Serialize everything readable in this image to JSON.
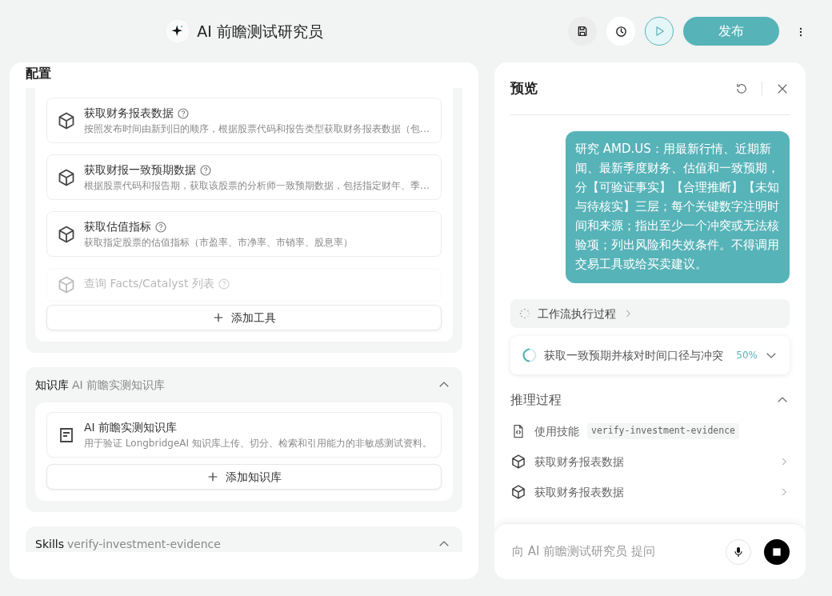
{
  "header": {
    "title": "AI 前瞻测试研究员",
    "publish_label": "发布"
  },
  "config": {
    "title": "配置",
    "tools": [
      {
        "name": "获取财务报表数据",
        "description": "按照发布时间由新到旧的顺序，根据股票代码和报告类型获取财务报表数据（包…"
      },
      {
        "name": "获取财报一致预期数据",
        "description": "根据股票代码和报告期，获取该股票的分析师一致预期数据，包括指定财年、季…"
      },
      {
        "name": "获取估值指标",
        "description": "获取指定股票的估值指标（市盈率、市净率、市销率、股息率）"
      },
      {
        "name": "查询 Facts/Catalyst 列表"
      }
    ],
    "add_tool_label": "添加工具",
    "sections": [
      {
        "kind": "knowledge",
        "title": "知识库",
        "subtitle": "AI 前瞻实测知识库",
        "expanded": true,
        "items": [
          {
            "name": "AI 前瞻实测知识库",
            "description": "用于验证 LongbridgeAI 知识库上传、切分、检索和引用能力的非敏感测试资料。"
          }
        ],
        "add_label": "添加知识库"
      },
      {
        "kind": "skills",
        "title": "Skills",
        "subtitle": "verify-investment-evidence",
        "expanded": true
      }
    ]
  },
  "preview": {
    "title": "预览",
    "message": "研究 AMD.US：用最新行情、近期新闻、最新季度财务、估值和一致预期，分【可验证事实】【合理推断】【未知与待核实】三层；每个关键数字注明时间和来源；指出至少一个冲突或无法核验项；列出风险和失效条件。不得调用交易工具或给买卖建议。",
    "workflow_label": "工作流执行过程",
    "task": {
      "label": "获取一致预期并核对时间口径与冲突",
      "percent": "50%",
      "expanded": false
    },
    "reasoning": {
      "title": "推理过程",
      "expanded": true,
      "steps": [
        {
          "kind": "skill",
          "label": "使用技能",
          "code": "verify-investment-evidence"
        },
        {
          "kind": "tool",
          "label": "获取财务报表数据"
        },
        {
          "kind": "tool",
          "label": "获取财务报表数据"
        }
      ]
    },
    "input": {
      "placeholder": "向 AI 前瞻测试研究员 提问"
    }
  }
}
